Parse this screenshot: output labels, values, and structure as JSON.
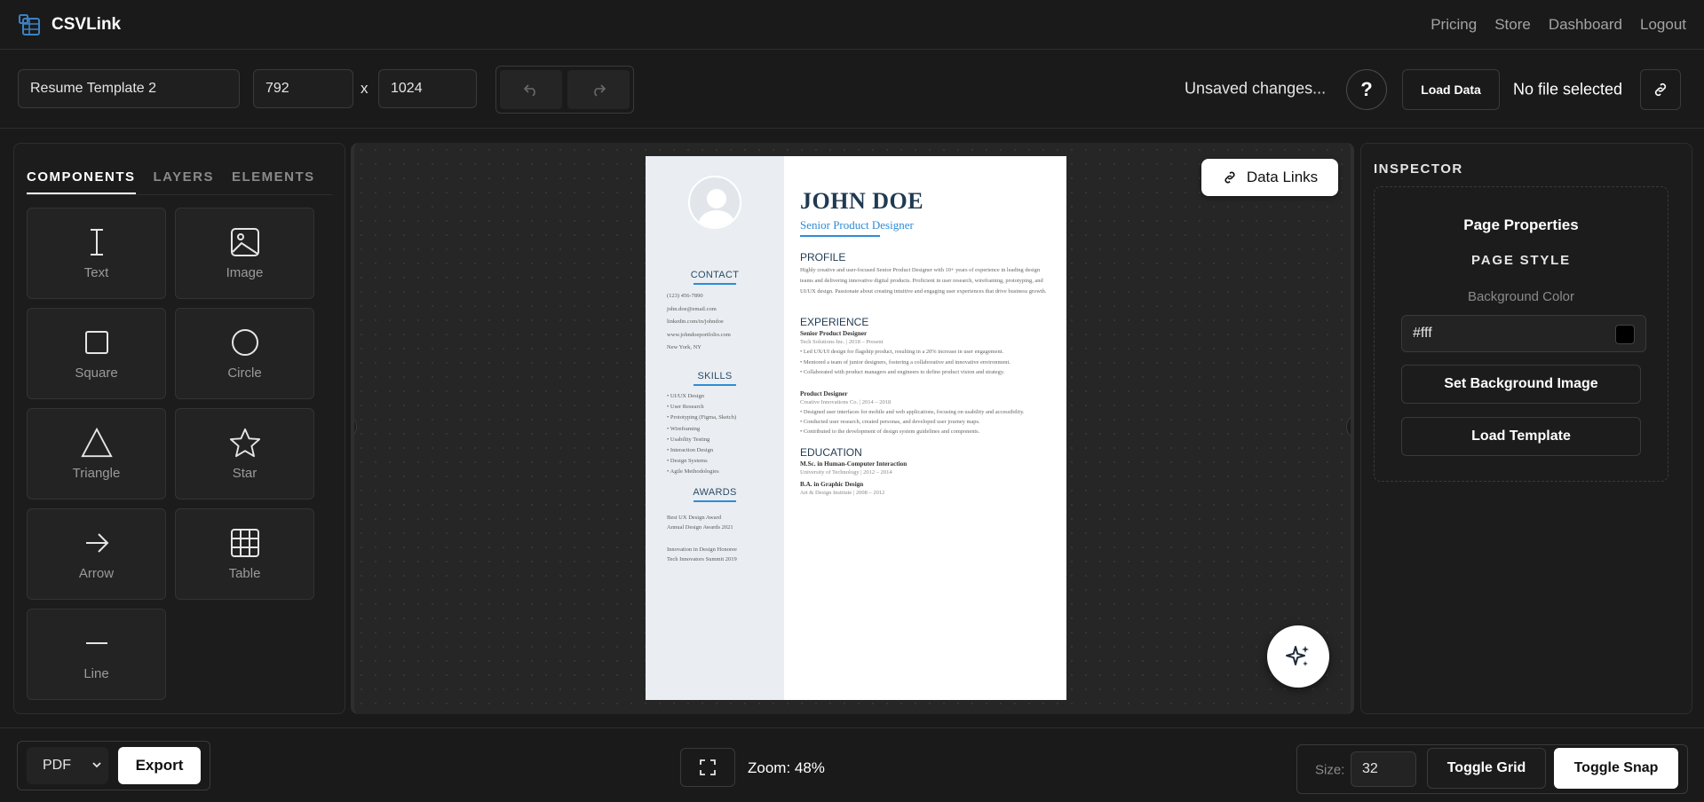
{
  "brand": {
    "name": "CSVLink"
  },
  "nav": {
    "items": [
      "Pricing",
      "Store",
      "Dashboard",
      "Logout"
    ]
  },
  "toolbar": {
    "template_name": "Resume Template 2",
    "width": "792",
    "times": "x",
    "height": "1024",
    "status": "Unsaved changes...",
    "help": "?",
    "load_data": "Load Data",
    "file_status": "No file selected"
  },
  "left": {
    "tabs": [
      "COMPONENTS",
      "LAYERS",
      "ELEMENTS"
    ],
    "components": [
      {
        "label": "Text",
        "icon": "text-icon"
      },
      {
        "label": "Image",
        "icon": "image-icon"
      },
      {
        "label": "Square",
        "icon": "square-icon"
      },
      {
        "label": "Circle",
        "icon": "circle-icon"
      },
      {
        "label": "Triangle",
        "icon": "triangle-icon"
      },
      {
        "label": "Star",
        "icon": "star-icon"
      },
      {
        "label": "Arrow",
        "icon": "arrow-icon"
      },
      {
        "label": "Table",
        "icon": "table-icon"
      },
      {
        "label": "Line",
        "icon": "line-icon"
      }
    ]
  },
  "canvas": {
    "data_links": "Data Links",
    "resume": {
      "sidebar": {
        "contact_heading": "CONTACT",
        "contact": [
          "(123) 456-7890",
          "john.doe@email.com",
          "linkedin.com/in/johndoe",
          "www.johndoeportfolio.com",
          "New York, NY"
        ],
        "skills_heading": "SKILLS",
        "skills": [
          "• UI/UX Design",
          "• User Research",
          "• Prototyping (Figma, Sketch)",
          "• Wireframing",
          "• Usability Testing",
          "• Interaction Design",
          "• Design Systems",
          "• Agile Methodologies"
        ],
        "awards_heading": "AWARDS",
        "awards": [
          "Best UX Design Award",
          "Annual Design Awards 2021",
          "",
          "Innovation in Design Honoree",
          "Tech Innovators Summit 2019"
        ]
      },
      "name": "JOHN DOE",
      "title": "Senior Product Designer",
      "profile_heading": "PROFILE",
      "profile": "Highly creative and user-focused Senior Product Designer with 10+ years of experience in leading design teams and delivering innovative digital products. Proficient in user research, wireframing, prototyping, and UI/UX design. Passionate about creating intuitive and engaging user experiences that drive business growth.",
      "experience_heading": "EXPERIENCE",
      "jobs": [
        {
          "role": "Senior Product Designer",
          "meta": "Tech Solutions Inc. | 2018 – Present",
          "bullets": [
            "• Led UX/UI design for flagship product, resulting in a 20% increase in user engagement.",
            "• Mentored a team of junior designers, fostering a collaborative and innovative environment.",
            "• Collaborated with product managers and engineers to define product vision and strategy."
          ]
        },
        {
          "role": "Product Designer",
          "meta": "Creative Innovations Co. | 2014 – 2018",
          "bullets": [
            "• Designed user interfaces for mobile and web applications, focusing on usability and accessibility.",
            "• Conducted user research, created personas, and developed user journey maps.",
            "• Contributed to the development of design system guidelines and components."
          ]
        }
      ],
      "education_heading": "EDUCATION",
      "education": [
        {
          "degree": "M.Sc. in Human-Computer Interaction",
          "meta": "University of Technology | 2012 – 2014"
        },
        {
          "degree": "B.A. in Graphic Design",
          "meta": "Art & Design Institute | 2008 – 2012"
        }
      ]
    }
  },
  "inspector": {
    "title": "INSPECTOR",
    "page_properties": "Page Properties",
    "page_style": "PAGE STYLE",
    "bg_label": "Background Color",
    "bg_value": "#fff",
    "set_bg_image": "Set Background Image",
    "load_template": "Load Template"
  },
  "bottom": {
    "format": "PDF",
    "export": "Export",
    "zoom": "Zoom: 48%",
    "size_label": "Size:",
    "size_value": "32",
    "toggle_grid": "Toggle Grid",
    "toggle_snap": "Toggle Snap"
  }
}
